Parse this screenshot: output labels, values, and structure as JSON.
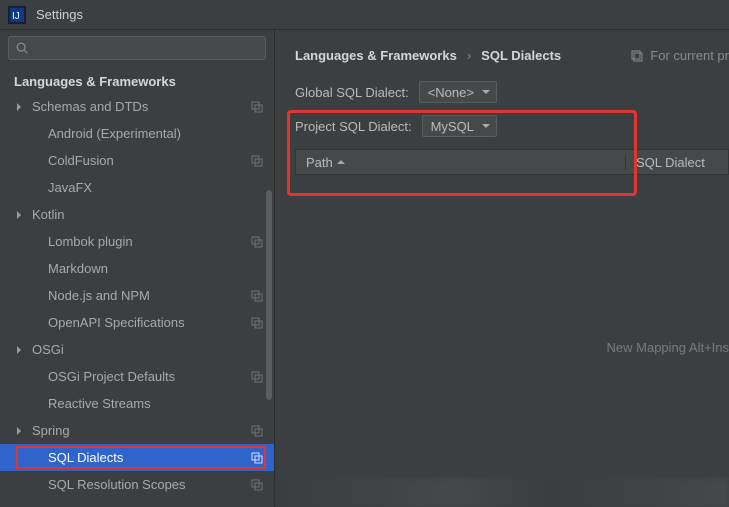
{
  "window": {
    "title": "Settings"
  },
  "search": {
    "placeholder": ""
  },
  "sidebar": {
    "header": "Languages & Frameworks",
    "items": [
      {
        "label": "Schemas and DTDs",
        "arrow": true,
        "copy": true,
        "level": 1
      },
      {
        "label": "Android (Experimental)",
        "arrow": false,
        "copy": false,
        "level": 2
      },
      {
        "label": "ColdFusion",
        "arrow": false,
        "copy": true,
        "level": 2
      },
      {
        "label": "JavaFX",
        "arrow": false,
        "copy": false,
        "level": 2
      },
      {
        "label": "Kotlin",
        "arrow": true,
        "copy": false,
        "level": 1
      },
      {
        "label": "Lombok plugin",
        "arrow": false,
        "copy": true,
        "level": 2
      },
      {
        "label": "Markdown",
        "arrow": false,
        "copy": false,
        "level": 2
      },
      {
        "label": "Node.js and NPM",
        "arrow": false,
        "copy": true,
        "level": 2
      },
      {
        "label": "OpenAPI Specifications",
        "arrow": false,
        "copy": true,
        "level": 2
      },
      {
        "label": "OSGi",
        "arrow": true,
        "copy": false,
        "level": 1
      },
      {
        "label": "OSGi Project Defaults",
        "arrow": false,
        "copy": true,
        "level": 2
      },
      {
        "label": "Reactive Streams",
        "arrow": false,
        "copy": false,
        "level": 2
      },
      {
        "label": "Spring",
        "arrow": true,
        "copy": true,
        "level": 1
      },
      {
        "label": "SQL Dialects",
        "arrow": false,
        "copy": true,
        "level": 2,
        "selected": true,
        "hl": true
      },
      {
        "label": "SQL Resolution Scopes",
        "arrow": false,
        "copy": true,
        "level": 2
      }
    ]
  },
  "main": {
    "breadcrumb": {
      "parent": "Languages & Frameworks",
      "current": "SQL Dialects"
    },
    "toolbar_right": "For current pr",
    "global_label": "Global SQL Dialect:",
    "global_value": "<None>",
    "project_label": "Project SQL Dialect:",
    "project_value": "MySQL",
    "table": {
      "col_path": "Path",
      "col_dialect": "SQL Dialect"
    },
    "hint": "New Mapping Alt+Ins"
  }
}
